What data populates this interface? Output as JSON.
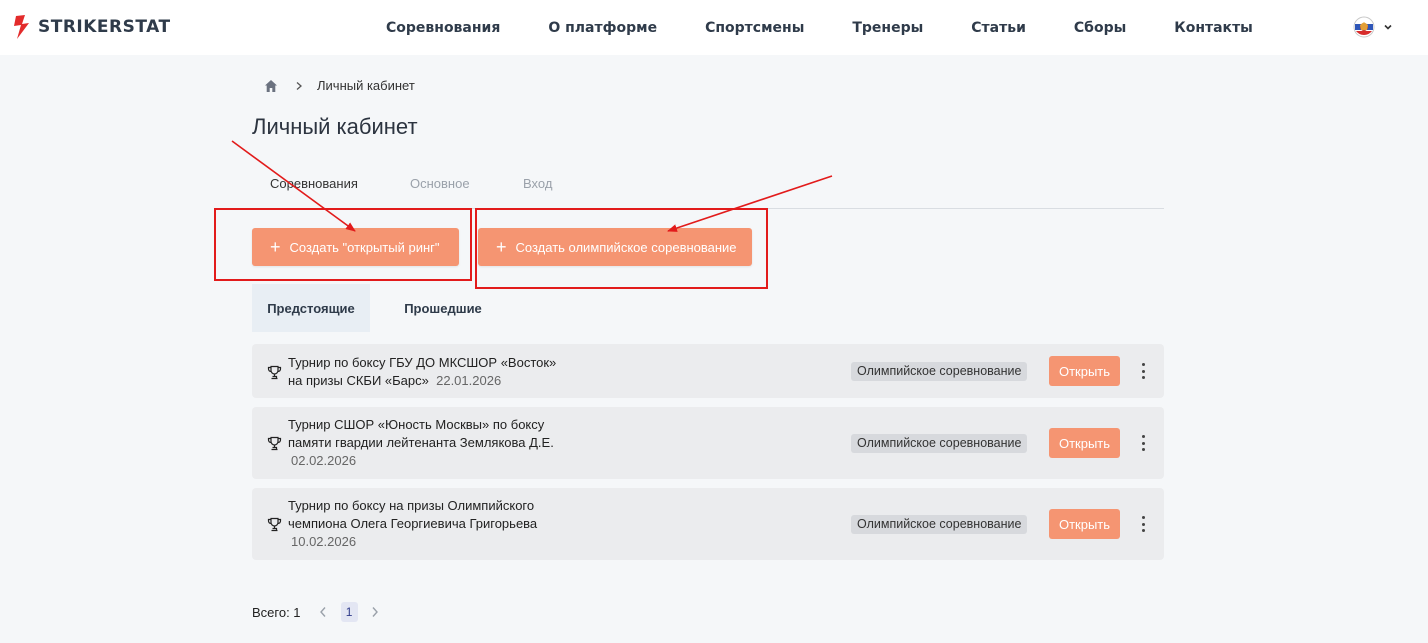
{
  "brand": {
    "name": "STRIKERSTAT",
    "accent": "#f59572",
    "logo_red": "#e32b2b"
  },
  "nav": {
    "items": [
      {
        "label": "Соревнования"
      },
      {
        "label": "О платформе"
      },
      {
        "label": "Спортсмены"
      },
      {
        "label": "Тренеры"
      },
      {
        "label": "Статьи"
      },
      {
        "label": "Сборы"
      },
      {
        "label": "Контакты"
      }
    ]
  },
  "language": {
    "icon": "flag-icon"
  },
  "breadcrumb": {
    "home_icon": "home-icon",
    "current": "Личный кабинет"
  },
  "page": {
    "title": "Личный кабинет"
  },
  "tabs": [
    {
      "label": "Соревнования",
      "active": true
    },
    {
      "label": "Основное",
      "active": false
    },
    {
      "label": "Вход",
      "active": false
    }
  ],
  "actions": {
    "create_open_ring": "Создать \"открытый ринг\"",
    "create_olympic": "Создать олимпийское соревнование"
  },
  "subtabs": [
    {
      "label": "Предстоящие",
      "active": true
    },
    {
      "label": "Прошедшие",
      "active": false
    }
  ],
  "competitions": [
    {
      "title_line1": "Турнир по боксу ГБУ ДО МКСШОР «Восток»",
      "title_line2": "на призы СКБИ «Барс»",
      "date": "22.01.2026",
      "type": "Олимпийское соревнование",
      "open_label": "Открыть"
    },
    {
      "title_line1": "Турнир СШОР «Юность Москвы» по боксу",
      "title_line2": "памяти гвардии лейтенанта Землякова Д.Е.",
      "date": "02.02.2026",
      "type": "Олимпийское соревнование",
      "open_label": "Открыть"
    },
    {
      "title_line1": "Турнир по боксу на призы Олимпийского",
      "title_line2": "чемпиона Олега Георгиевича Григорьева",
      "date": "10.02.2026",
      "type": "Олимпийское соревнование",
      "open_label": "Открыть"
    }
  ],
  "pagination": {
    "total_label": "Всего: 1",
    "current_page": "1"
  }
}
